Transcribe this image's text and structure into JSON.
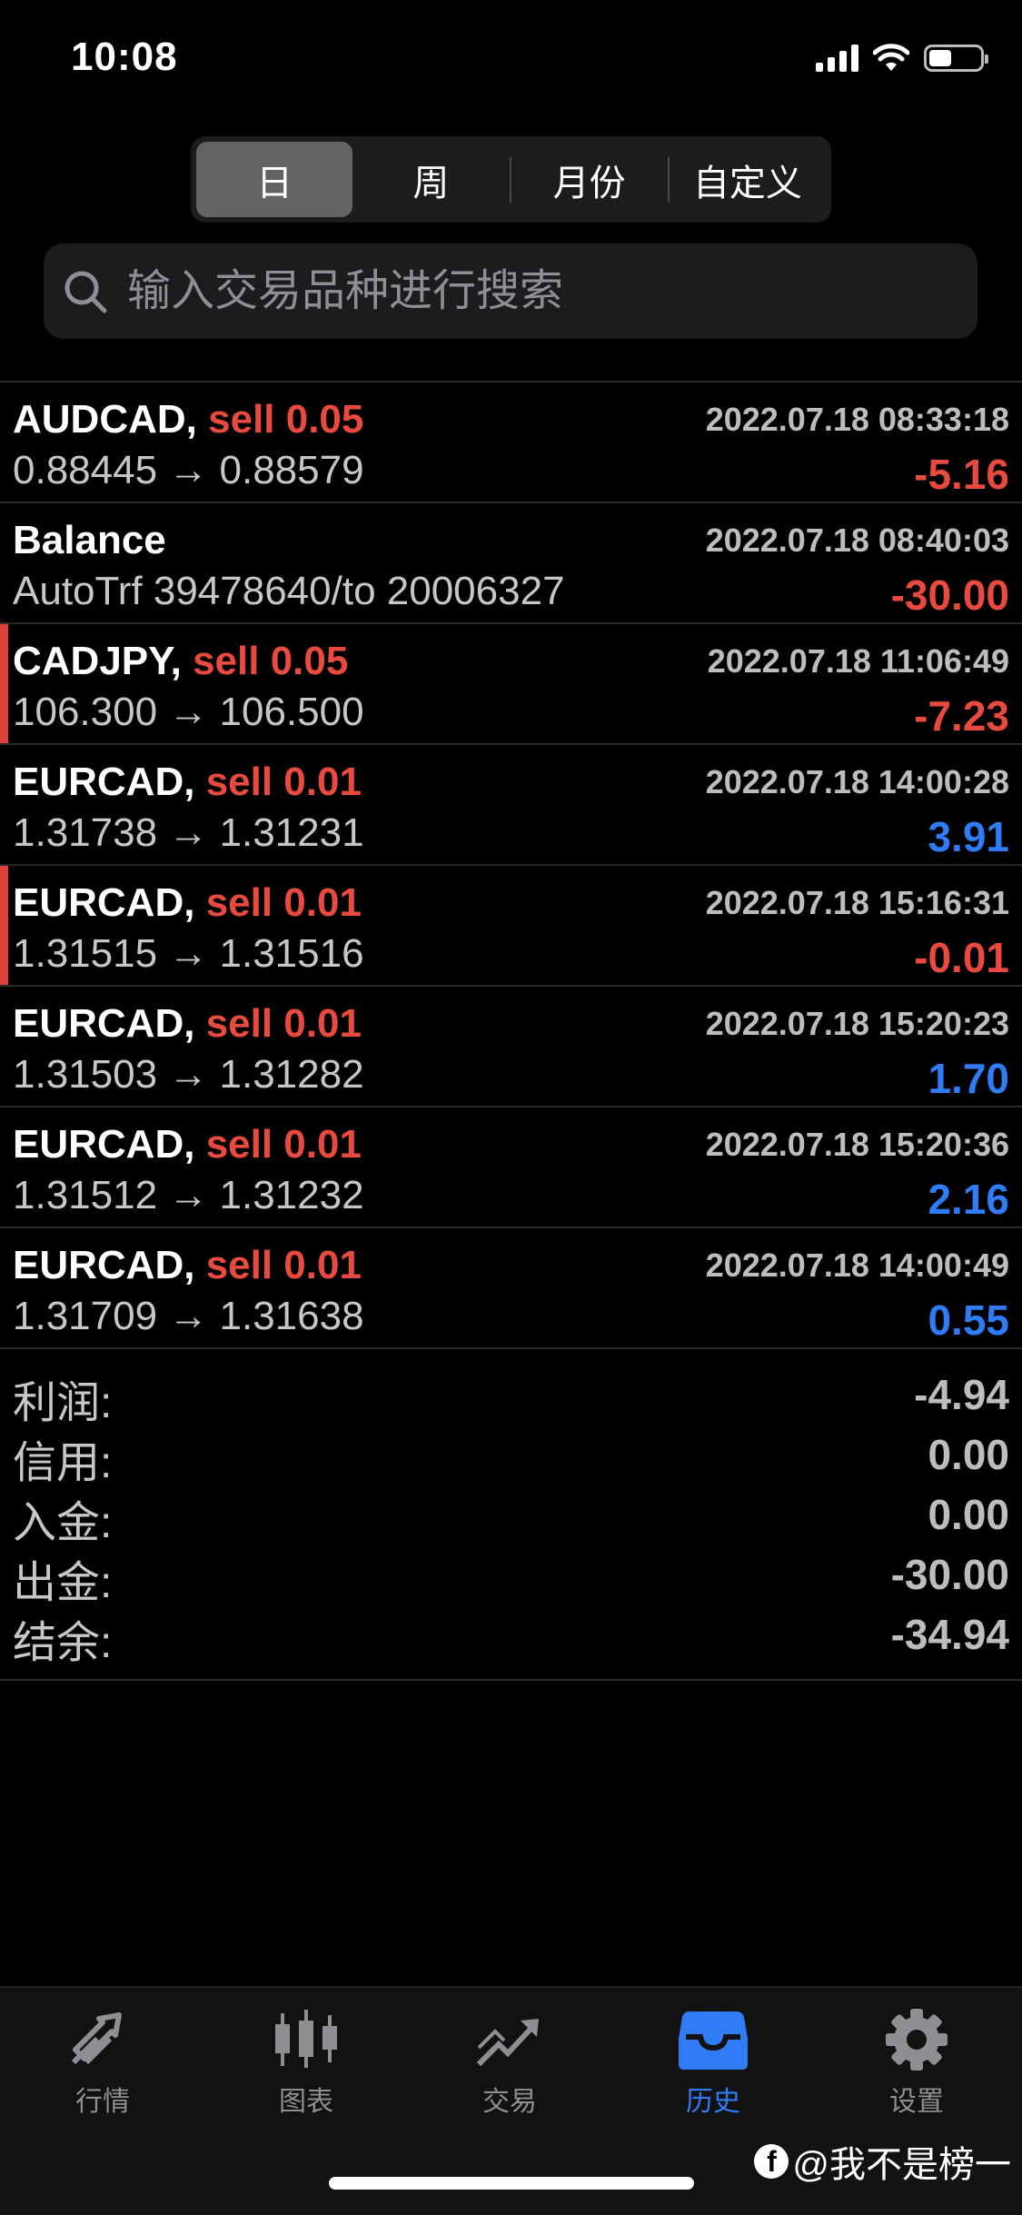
{
  "status_bar": {
    "time": "10:08"
  },
  "segmented": [
    "日",
    "周",
    "月份",
    "自定义"
  ],
  "search": {
    "placeholder": "输入交易品种进行搜索"
  },
  "trades": [
    {
      "symbol": "AUDCAD,",
      "side": "sell 0.05",
      "time": "2022.07.18 08:33:18",
      "detail": "0.88445 → 0.88579",
      "pl": "-5.16",
      "sign": "neg"
    },
    {
      "symbol": "Balance",
      "side": "",
      "time": "2022.07.18 08:40:03",
      "detail": "AutoTrf 39478640/to 20006327",
      "pl": "-30.00",
      "sign": "neg"
    },
    {
      "symbol": "CADJPY,",
      "side": "sell 0.05",
      "time": "2022.07.18 11:06:49",
      "detail": "106.300 → 106.500",
      "pl": "-7.23",
      "sign": "neg"
    },
    {
      "symbol": "EURCAD,",
      "side": "sell 0.01",
      "time": "2022.07.18 14:00:28",
      "detail": "1.31738 → 1.31231",
      "pl": "3.91",
      "sign": "pos"
    },
    {
      "symbol": "EURCAD,",
      "side": "sell 0.01",
      "time": "2022.07.18 15:16:31",
      "detail": "1.31515 → 1.31516",
      "pl": "-0.01",
      "sign": "neg"
    },
    {
      "symbol": "EURCAD,",
      "side": "sell 0.01",
      "time": "2022.07.18 15:20:23",
      "detail": "1.31503 → 1.31282",
      "pl": "1.70",
      "sign": "pos"
    },
    {
      "symbol": "EURCAD,",
      "side": "sell 0.01",
      "time": "2022.07.18 15:20:36",
      "detail": "1.31512 → 1.31232",
      "pl": "2.16",
      "sign": "pos"
    },
    {
      "symbol": "EURCAD,",
      "side": "sell 0.01",
      "time": "2022.07.18 14:00:49",
      "detail": "1.31709 → 1.31638",
      "pl": "0.55",
      "sign": "pos"
    }
  ],
  "summary": [
    {
      "label": "利润:",
      "value": "-4.94"
    },
    {
      "label": "信用:",
      "value": "0.00"
    },
    {
      "label": "入金:",
      "value": "0.00"
    },
    {
      "label": "出金:",
      "value": "-30.00"
    },
    {
      "label": "结余:",
      "value": "-34.94"
    }
  ],
  "tabs": [
    "行情",
    "图表",
    "交易",
    "历史",
    "设置"
  ],
  "watermark": "@我不是榜一",
  "colors": {
    "sell": "#e84a3f",
    "positive": "#2f7cf6",
    "negative": "#e84a3f",
    "active_tab": "#2f7cf6"
  }
}
